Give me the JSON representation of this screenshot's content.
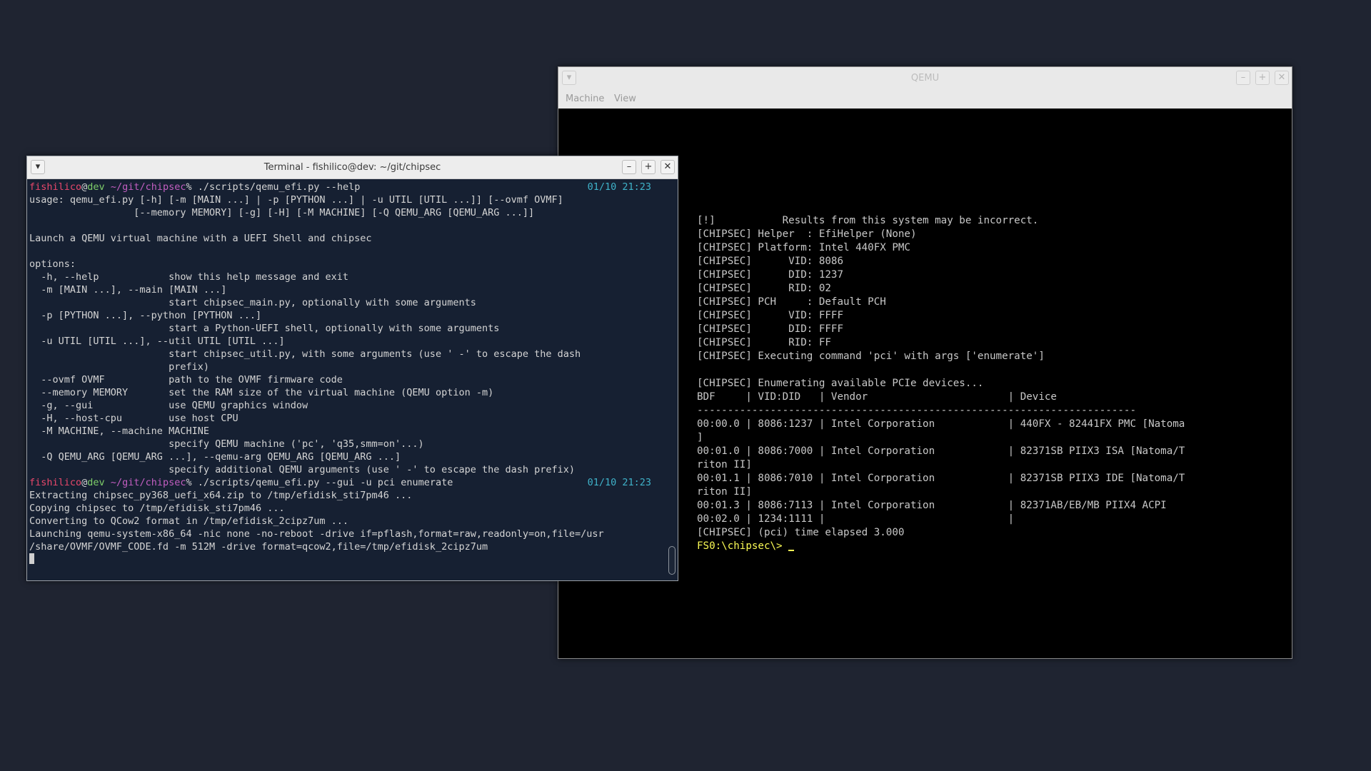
{
  "qemu": {
    "title": "QEMU",
    "menu": [
      "Machine",
      "View"
    ],
    "console_lines": [
      "[!]           Results from this system may be incorrect.",
      "[CHIPSEC] Helper  : EfiHelper (None)",
      "[CHIPSEC] Platform: Intel 440FX PMC",
      "[CHIPSEC]      VID: 8086",
      "[CHIPSEC]      DID: 1237",
      "[CHIPSEC]      RID: 02",
      "[CHIPSEC] PCH     : Default PCH",
      "[CHIPSEC]      VID: FFFF",
      "[CHIPSEC]      DID: FFFF",
      "[CHIPSEC]      RID: FF",
      "[CHIPSEC] Executing command 'pci' with args ['enumerate']",
      "",
      "[CHIPSEC] Enumerating available PCIe devices...",
      "BDF     | VID:DID   | Vendor                       | Device",
      "------------------------------------------------------------------------",
      "00:00.0 | 8086:1237 | Intel Corporation            | 440FX - 82441FX PMC [Natoma",
      "]",
      "00:01.0 | 8086:7000 | Intel Corporation            | 82371SB PIIX3 ISA [Natoma/T",
      "riton II]",
      "00:01.1 | 8086:7010 | Intel Corporation            | 82371SB PIIX3 IDE [Natoma/T",
      "riton II]",
      "00:01.3 | 8086:7113 | Intel Corporation            | 82371AB/EB/MB PIIX4 ACPI",
      "00:02.0 | 1234:1111 |                              |",
      "[CHIPSEC] (pci) time elapsed 3.000"
    ],
    "prompt": "FS0:\\chipsec\\> "
  },
  "terminal": {
    "title": "Terminal - fishilico@dev: ~/git/chipsec",
    "prompt": {
      "user": "fishilico",
      "at": "@",
      "host": "dev",
      "path": " ~/git/chipsec",
      "suffix": "% "
    },
    "commands": [
      {
        "cmd": "./scripts/qemu_efi.py --help",
        "time": "01/10 21:23"
      },
      {
        "cmd": "./scripts/qemu_efi.py --gui -u pci enumerate",
        "time": "01/10 21:23"
      }
    ],
    "help_output": [
      "usage: qemu_efi.py [-h] [-m [MAIN ...] | -p [PYTHON ...] | -u UTIL [UTIL ...]] [--ovmf OVMF]",
      "                  [--memory MEMORY] [-g] [-H] [-M MACHINE] [-Q QEMU_ARG [QEMU_ARG ...]]",
      "",
      "Launch a QEMU virtual machine with a UEFI Shell and chipsec",
      "",
      "options:",
      "  -h, --help            show this help message and exit",
      "  -m [MAIN ...], --main [MAIN ...]",
      "                        start chipsec_main.py, optionally with some arguments",
      "  -p [PYTHON ...], --python [PYTHON ...]",
      "                        start a Python-UEFI shell, optionally with some arguments",
      "  -u UTIL [UTIL ...], --util UTIL [UTIL ...]",
      "                        start chipsec_util.py, with some arguments (use ' -' to escape the dash",
      "                        prefix)",
      "  --ovmf OVMF           path to the OVMF firmware code",
      "  --memory MEMORY       set the RAM size of the virtual machine (QEMU option -m)",
      "  -g, --gui             use QEMU graphics window",
      "  -H, --host-cpu        use host CPU",
      "  -M MACHINE, --machine MACHINE",
      "                        specify QEMU machine ('pc', 'q35,smm=on'...)",
      "  -Q QEMU_ARG [QEMU_ARG ...], --qemu-arg QEMU_ARG [QEMU_ARG ...]",
      "                        specify additional QEMU arguments (use ' -' to escape the dash prefix)"
    ],
    "run_output": [
      "Extracting chipsec_py368_uefi_x64.zip to /tmp/efidisk_sti7pm46 ...",
      "Copying chipsec to /tmp/efidisk_sti7pm46 ...",
      "Converting to QCow2 format in /tmp/efidisk_2cipz7um ...",
      "Launching qemu-system-x86_64 -nic none -no-reboot -drive if=pflash,format=raw,readonly=on,file=/usr",
      "/share/OVMF/OVMF_CODE.fd -m 512M -drive format=qcow2,file=/tmp/efidisk_2cipz7um"
    ]
  },
  "icons": {
    "menu": "chevron-down-icon",
    "minimize": "minimize-icon",
    "maximize": "maximize-icon",
    "close": "close-icon"
  }
}
